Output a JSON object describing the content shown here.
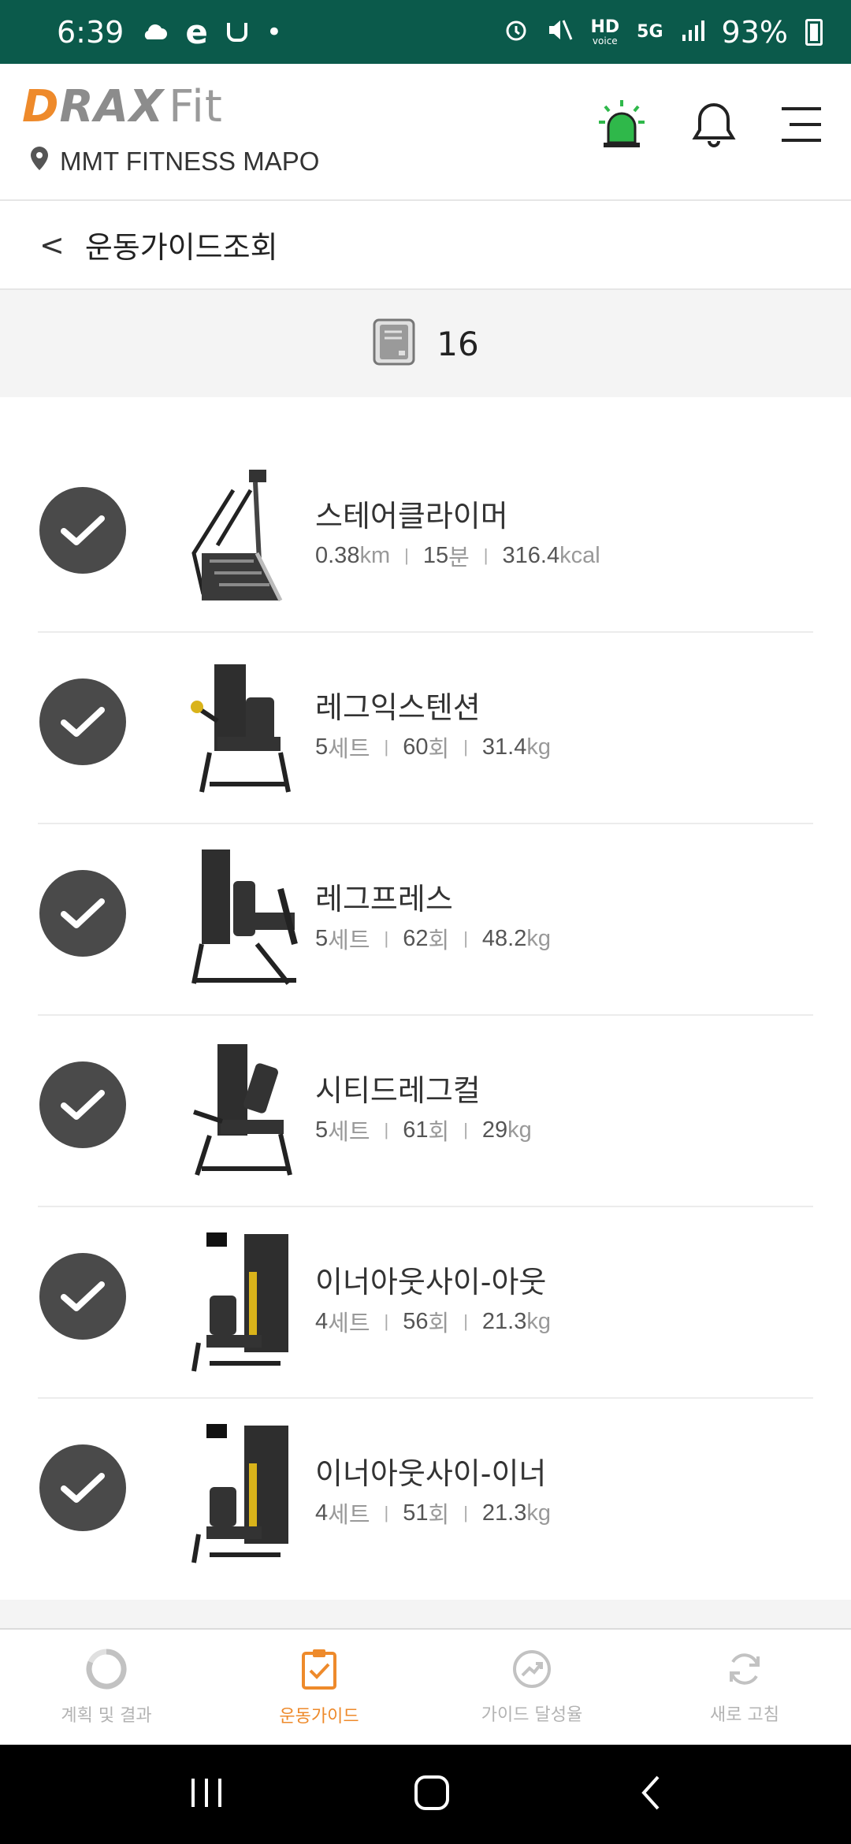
{
  "status_bar": {
    "time": "6:39",
    "left_icons": [
      "cloud-icon",
      "e-app-icon",
      "app-icon",
      "dot-icon"
    ],
    "right_icons": [
      "alarm-icon",
      "mute-icon",
      "hd-voice-icon",
      "5g-icon",
      "signal-icon"
    ],
    "hd_label": "HD",
    "hd_sub": "voice",
    "network": "5G",
    "battery": "93%"
  },
  "header": {
    "logo_part1": "D",
    "logo_part2": "RAX",
    "logo_part3": "Fit",
    "location": "MMT FITNESS MAPO",
    "icons": [
      "alarm-siren-icon",
      "bell-icon",
      "menu-icon"
    ],
    "siren_color": "#2fb84a"
  },
  "subheader": {
    "back": "<",
    "title": "운동가이드조회"
  },
  "count": {
    "value": "16"
  },
  "exercises": [
    {
      "name": "스테어클라이머",
      "m1v": "0.38",
      "m1u": "km",
      "m2v": "15",
      "m2u": "분",
      "m3v": "316.4",
      "m3u": "kcal"
    },
    {
      "name": "레그익스텐션",
      "m1v": "5",
      "m1u": "세트",
      "m2v": "60",
      "m2u": "회",
      "m3v": "31.4",
      "m3u": "kg"
    },
    {
      "name": "레그프레스",
      "m1v": "5",
      "m1u": "세트",
      "m2v": "62",
      "m2u": "회",
      "m3v": "48.2",
      "m3u": "kg"
    },
    {
      "name": "시티드레그컬",
      "m1v": "5",
      "m1u": "세트",
      "m2v": "61",
      "m2u": "회",
      "m3v": "29",
      "m3u": "kg"
    },
    {
      "name": "이너아웃사이-아웃",
      "m1v": "4",
      "m1u": "세트",
      "m2v": "56",
      "m2u": "회",
      "m3v": "21.3",
      "m3u": "kg"
    },
    {
      "name": "이너아웃사이-이너",
      "m1v": "4",
      "m1u": "세트",
      "m2v": "51",
      "m2u": "회",
      "m3v": "21.3",
      "m3u": "kg"
    }
  ],
  "tabs": [
    {
      "label": "계획 및 결과",
      "icon": "plan-result-icon",
      "active": false
    },
    {
      "label": "운동가이드",
      "icon": "clipboard-check-icon",
      "active": true
    },
    {
      "label": "가이드 달성율",
      "icon": "trend-up-icon",
      "active": false
    },
    {
      "label": "새로 고침",
      "icon": "refresh-icon",
      "active": false
    }
  ],
  "colors": {
    "status_bar": "#0b5a4b",
    "accent": "#ee8a2b",
    "check_circle": "#4a4a4a",
    "inactive_tab": "#b3b3b3"
  }
}
